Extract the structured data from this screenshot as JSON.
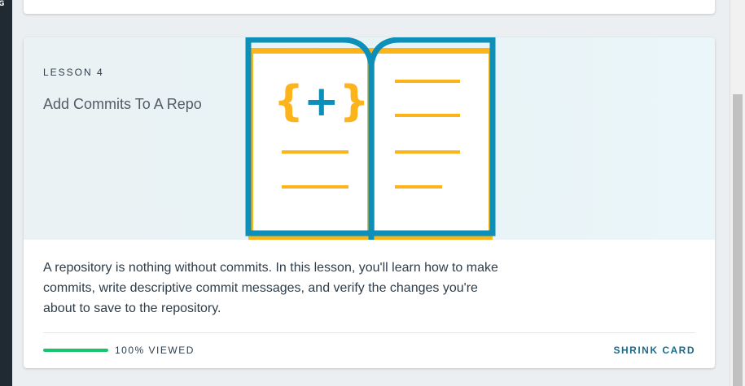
{
  "sidebar": {
    "clipped_label": "G"
  },
  "lesson_card": {
    "lesson_number": "LESSON 4",
    "title": "Add Commits To A Repo",
    "description": "A repository is nothing without commits. In this lesson, you'll learn how to make commits, write descriptive commit messages, and verify the changes you're about to save to the repository.",
    "illustration": {
      "icon": "open-book-code-icon",
      "glyph": "{+}",
      "book_color": "#0c8fb8",
      "accent_color": "#fdb31a"
    },
    "progress": {
      "percent": 100,
      "label": "100% VIEWED",
      "color": "#16c469"
    },
    "shrink_label": "SHRINK CARD",
    "accent_color": "#1d6a88"
  }
}
